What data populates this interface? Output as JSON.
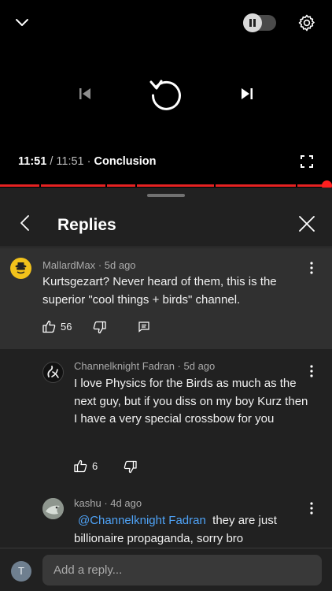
{
  "player": {
    "current_time": "11:51",
    "separator": "/",
    "duration": "11:51",
    "dot": "·",
    "chapter": "Conclusion",
    "progress_fraction": 1.0
  },
  "panel": {
    "title": "Replies"
  },
  "parent_comment": {
    "author": "MallardMax",
    "age": "5d ago",
    "text": "Kurtsgezart? Never heard of them, this is the superior \"cool things + birds\" channel.",
    "likes": "56"
  },
  "replies": [
    {
      "author": "Channelknight Fadran",
      "age": "5d ago",
      "text": "I love Physics for the Birds as much as the next guy, but if you diss on my boy Kurz then I have a very special crossbow for you",
      "likes": "6"
    },
    {
      "author": "kashu",
      "age": "4d ago",
      "mention": "@Channelknight Fadran",
      "text": "they are just billionaire propaganda, sorry bro"
    }
  ],
  "reply_bar": {
    "avatar_initial": "T",
    "placeholder": "Add a reply..."
  },
  "colors": {
    "progress": "#e52222",
    "mention": "#4fa3f7",
    "panel_bg": "#212121",
    "highlight_bg": "#303030"
  },
  "icons": [
    "chevron-down-icon",
    "pause-icon",
    "gear-icon",
    "previous-icon",
    "replay-icon",
    "next-icon",
    "fullscreen-icon",
    "back-arrow-icon",
    "close-icon",
    "more-icon",
    "thumb-up-icon",
    "thumb-down-icon",
    "reply-icon"
  ]
}
